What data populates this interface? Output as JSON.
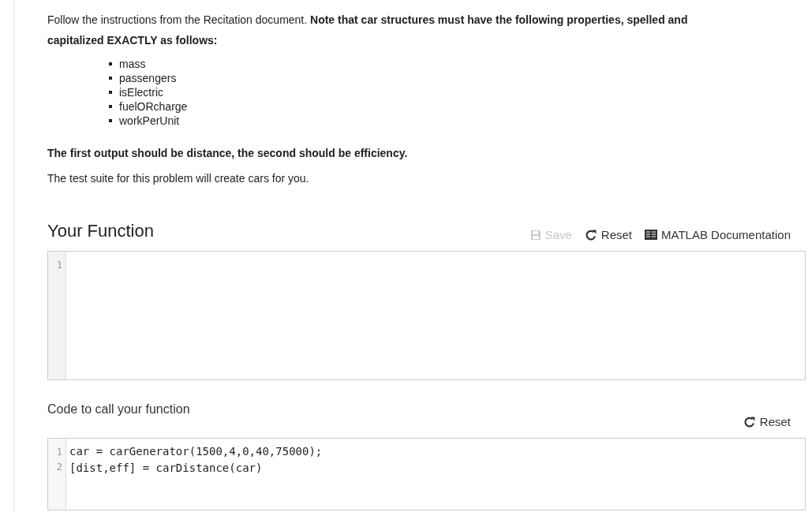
{
  "intro": "Follow the instructions from the Recitation document. **Note that car structures must have the following properties, spelled and capitalized EXACTLY as follows:**",
  "properties": [
    "mass",
    "passengers",
    "isElectric",
    "fuelORcharge",
    "workPerUnit"
  ],
  "output_note": "The first output should be distance, the second should be efficiency.",
  "test_note": "The test suite for this problem will create cars for you.",
  "function_section": {
    "title": "Your Function",
    "actions": [
      {
        "kind": "save",
        "label": "Save",
        "disabled": true
      },
      {
        "kind": "reset",
        "label": "Reset",
        "disabled": false
      },
      {
        "kind": "docs",
        "label": "MATLAB Documentation",
        "disabled": false
      }
    ],
    "editor": {
      "lines": [
        {
          "number": "1"
        }
      ]
    }
  },
  "call_section": {
    "title": "Code to call your function",
    "actions": [
      {
        "kind": "reset",
        "label": "Reset",
        "disabled": false
      }
    ],
    "editor": {
      "lines": [
        {
          "number": "1",
          "code": "car = carGenerator(1500,4,0,40,75000);"
        },
        {
          "number": "2",
          "code": "[dist,eff] = carDistance(car)"
        }
      ]
    }
  }
}
